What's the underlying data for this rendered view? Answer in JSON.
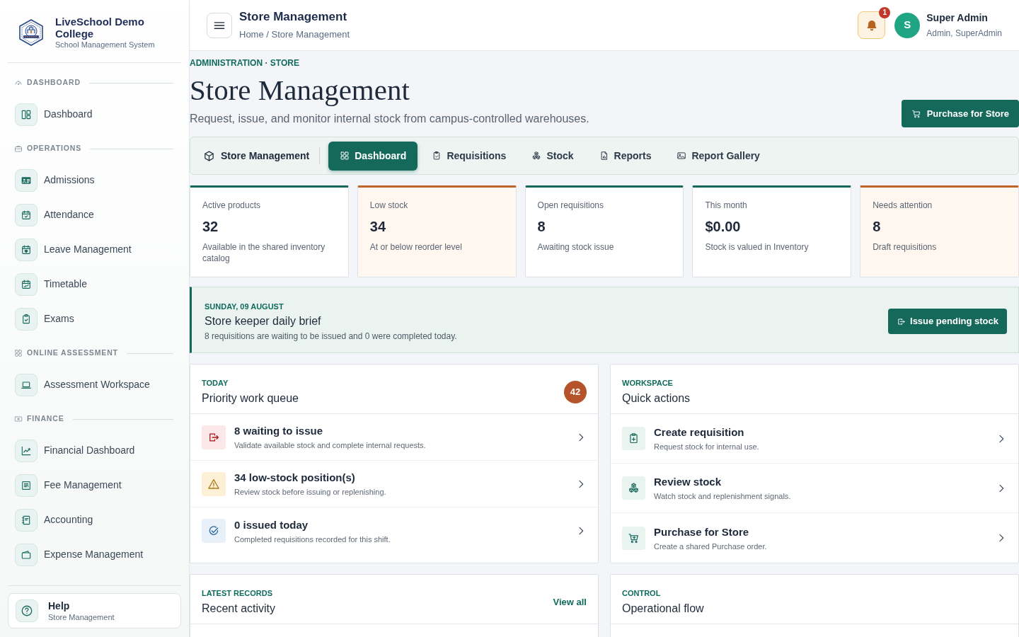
{
  "sidebar": {
    "brand": {
      "title": "LiveSchool Demo College",
      "subtitle": "School Management System"
    },
    "sections": [
      {
        "heading": "DASHBOARD",
        "items": [
          {
            "label": "Dashboard",
            "selected": false
          }
        ]
      },
      {
        "heading": "OPERATIONS",
        "items": [
          {
            "label": "Admissions",
            "selected": false
          },
          {
            "label": "Attendance",
            "selected": false
          },
          {
            "label": "Leave Management",
            "selected": false
          },
          {
            "label": "Timetable",
            "selected": false
          },
          {
            "label": "Exams",
            "selected": false
          }
        ]
      },
      {
        "heading": "ONLINE ASSESSMENT",
        "items": [
          {
            "label": "Assessment Workspace",
            "selected": false
          }
        ]
      },
      {
        "heading": "FINANCE",
        "items": [
          {
            "label": "Financial Dashboard",
            "selected": false
          },
          {
            "label": "Fee Management",
            "selected": false
          },
          {
            "label": "Accounting",
            "selected": false
          },
          {
            "label": "Expense Management",
            "selected": false
          }
        ]
      }
    ],
    "help": {
      "title": "Help",
      "subtitle": "Store Management"
    }
  },
  "topbar": {
    "title": "Store Management",
    "breadcrumb": "Home / Store Management",
    "notifications": "1",
    "user": {
      "initial": "S",
      "name": "Super Admin",
      "role": "Admin, SuperAdmin"
    }
  },
  "page": {
    "eyebrow": "ADMINISTRATION · STORE",
    "title": "Store Management",
    "subtitle": "Request, issue, and monitor internal stock from campus-controlled warehouses.",
    "action": "Purchase for Store"
  },
  "module_nav": {
    "title": "Store Management",
    "tabs": [
      {
        "label": "Dashboard",
        "selected": true
      },
      {
        "label": "Requisitions",
        "selected": false
      },
      {
        "label": "Stock",
        "selected": false
      },
      {
        "label": "Reports",
        "selected": false
      },
      {
        "label": "Report Gallery",
        "selected": false
      }
    ]
  },
  "stats": [
    {
      "label": "Active products",
      "value": "32",
      "note": "Available in the shared inventory catalog",
      "color": "#15695b",
      "highlighted": false
    },
    {
      "label": "Low stock",
      "value": "34",
      "note": "At or below reorder level",
      "color": "#c1642a",
      "highlighted": true
    },
    {
      "label": "Open requisitions",
      "value": "8",
      "note": "Awaiting stock issue",
      "color": "#15695b",
      "highlighted": false
    },
    {
      "label": "This month",
      "value": "$0.00",
      "note": "Stock is valued in Inventory",
      "color": "#15695b",
      "highlighted": false
    },
    {
      "label": "Needs attention",
      "value": "8",
      "note": "Draft requisitions",
      "color": "#c1642a",
      "highlighted": true
    }
  ],
  "brief": {
    "date": "SUNDAY, 09 AUGUST",
    "title": "Store keeper daily brief",
    "text": "8 requisitions are waiting to be issued and 0 were completed today.",
    "action": "Issue pending stock"
  },
  "work_queue": {
    "eyebrow": "TODAY",
    "title": "Priority work queue",
    "count": "42",
    "items": [
      {
        "title": "8 waiting to issue",
        "text": "Validate available stock and complete internal requests.",
        "color": "#fce8e8"
      },
      {
        "title": "34 low-stock position(s)",
        "text": "Review stock before issuing or replenishing.",
        "color": "#fdf0d6"
      },
      {
        "title": "0 issued today",
        "text": "Completed requisitions recorded for this shift.",
        "color": "#e8f1f9"
      }
    ]
  },
  "quick_actions": {
    "eyebrow": "WORKSPACE",
    "title": "Quick actions",
    "items": [
      {
        "title": "Create requisition",
        "text": "Request stock for internal use."
      },
      {
        "title": "Review stock",
        "text": "Watch stock and replenishment signals."
      },
      {
        "title": "Purchase for Store",
        "text": "Create a shared Purchase order."
      }
    ]
  },
  "recent_activity": {
    "eyebrow": "LATEST RECORDS",
    "title": "Recent activity",
    "link": "View all"
  },
  "operational_flow": {
    "eyebrow": "CONTROL",
    "title": "Operational flow"
  }
}
